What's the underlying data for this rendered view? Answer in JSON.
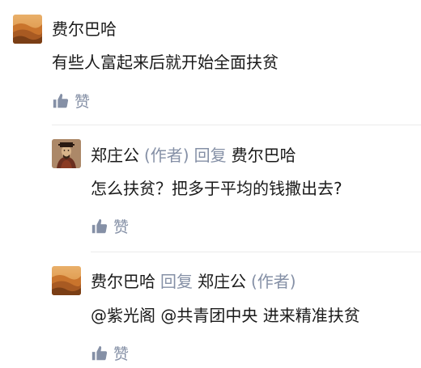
{
  "comments": [
    {
      "user": "费尔巴哈",
      "text": "有些人富起来后就开始全面扶贫",
      "like_label": "赞"
    },
    {
      "user": "郑庄公",
      "author_tag": "(作者)",
      "reply_word": "回复",
      "reply_to": "费尔巴哈",
      "text": "怎么扶贫？把多于平均的钱撒出去?",
      "like_label": "赞"
    },
    {
      "user": "费尔巴哈",
      "reply_word": "回复",
      "reply_to": "郑庄公",
      "reply_to_tag": "(作者)",
      "text": "@紫光阁 @共青团中央 进来精准扶贫",
      "like_label": "赞"
    }
  ],
  "icons": {
    "like": "thumbs-up-icon"
  },
  "colors": {
    "meta_gray": "#8590a6",
    "text": "#1a1a1a",
    "divider": "#ebebeb"
  }
}
